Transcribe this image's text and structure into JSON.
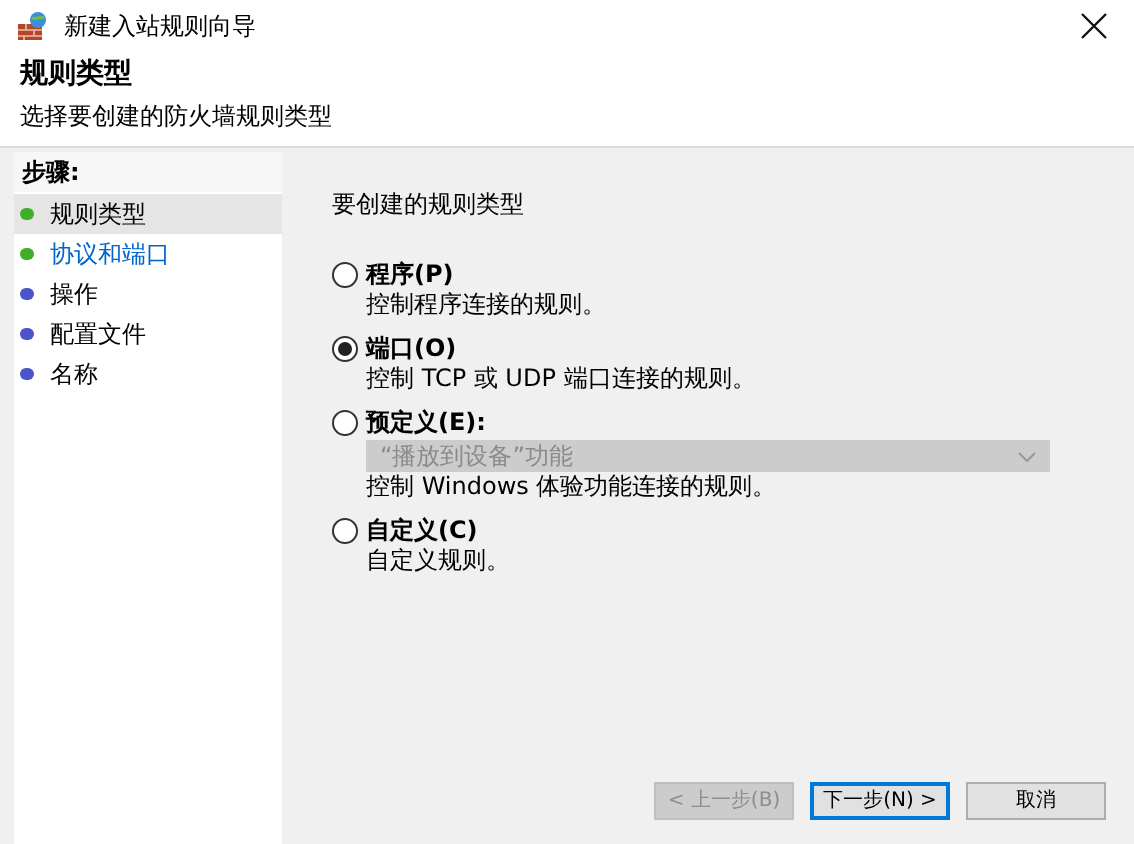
{
  "window": {
    "title": "新建入站规则向导"
  },
  "header": {
    "title": "规则类型",
    "subtitle": "选择要创建的防火墙规则类型"
  },
  "steps": {
    "title": "步骤:",
    "items": [
      {
        "label": "规则类型",
        "selected": true,
        "done": true,
        "link": false
      },
      {
        "label": "协议和端口",
        "selected": false,
        "done": true,
        "link": true
      },
      {
        "label": "操作",
        "selected": false,
        "done": false,
        "link": false
      },
      {
        "label": "配置文件",
        "selected": false,
        "done": false,
        "link": false
      },
      {
        "label": "名称",
        "selected": false,
        "done": false,
        "link": false
      }
    ]
  },
  "prompt": "要创建的规则类型",
  "options": [
    {
      "label": "程序(P)",
      "description": "控制程序连接的规则。",
      "selected": false
    },
    {
      "label": "端口(O)",
      "description": "控制 TCP 或 UDP 端口连接的规则。",
      "selected": true
    },
    {
      "label": "预定义(E):",
      "description": "控制 Windows 体验功能连接的规则。",
      "selected": false,
      "dropdown": {
        "value": "“播放到设备”功能",
        "disabled": true
      }
    },
    {
      "label": "自定义(C)",
      "description": "自定义规则。",
      "selected": false
    }
  ],
  "buttons": [
    {
      "label": "< 上一步(B)",
      "disabled": true,
      "default": false
    },
    {
      "label": "下一步(N) >",
      "disabled": false,
      "default": true
    },
    {
      "label": "取消",
      "disabled": false,
      "default": false
    }
  ]
}
